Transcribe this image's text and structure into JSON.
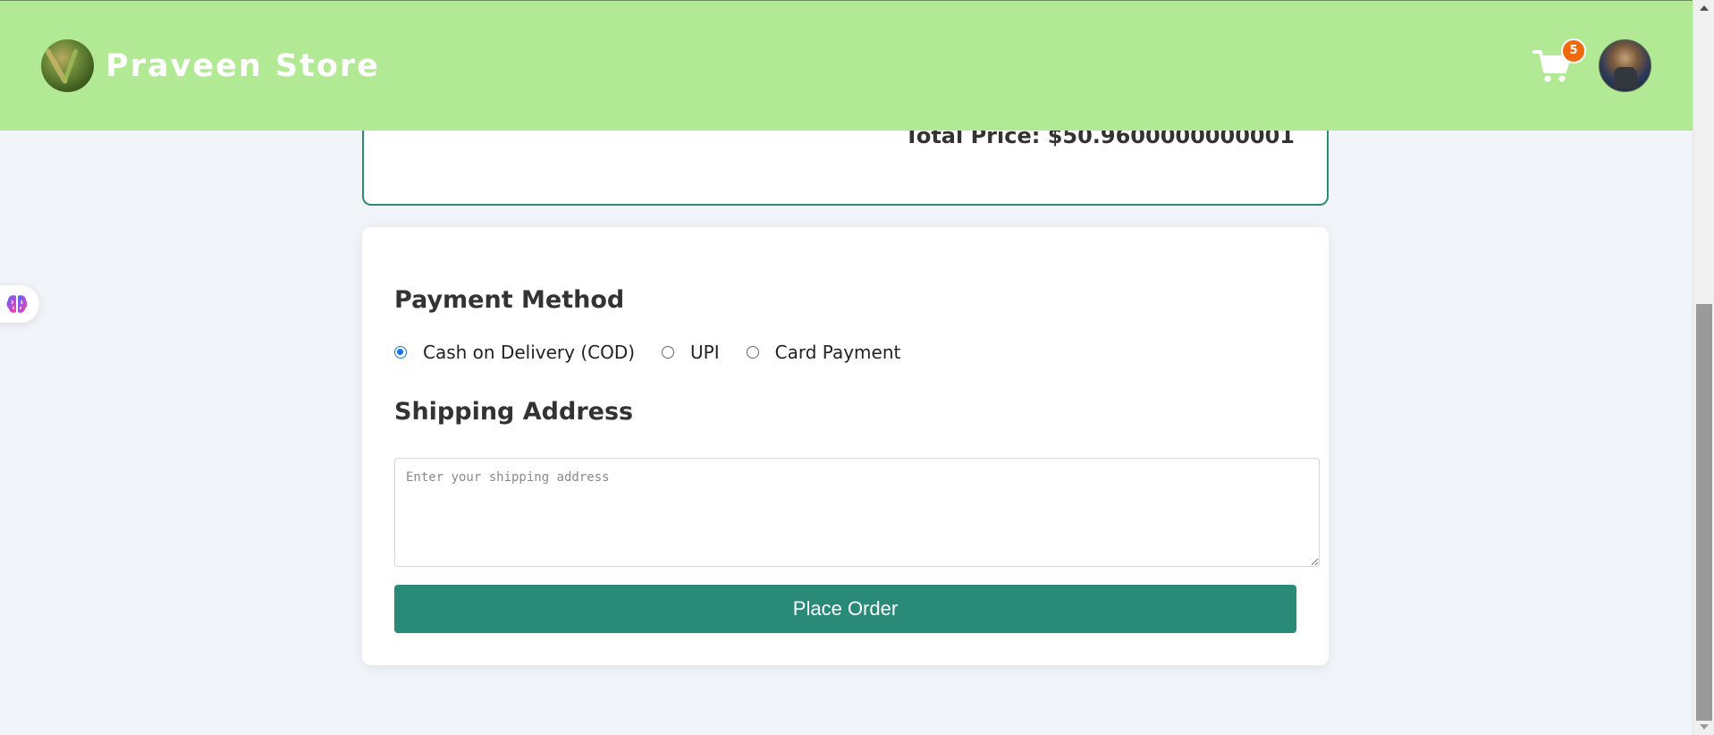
{
  "header": {
    "store_name": "Praveen Store",
    "cart_count": "5"
  },
  "summary": {
    "total_price": "Total Price: $50.9600000000001"
  },
  "payment": {
    "title": "Payment Method",
    "options": [
      {
        "label": "Cash on Delivery (COD)",
        "selected": true
      },
      {
        "label": "UPI",
        "selected": false
      },
      {
        "label": "Card Payment",
        "selected": false
      }
    ]
  },
  "shipping": {
    "title": "Shipping Address",
    "placeholder": "Enter your shipping address",
    "value": ""
  },
  "actions": {
    "place_order_label": "Place Order"
  },
  "colors": {
    "header_bg": "#b2e994",
    "primary": "#2a8a78",
    "badge": "#f06a0c",
    "radio_selected": "#1a73e8"
  },
  "icons": {
    "cart": "cart-icon",
    "side_widget": "brain-icon"
  }
}
